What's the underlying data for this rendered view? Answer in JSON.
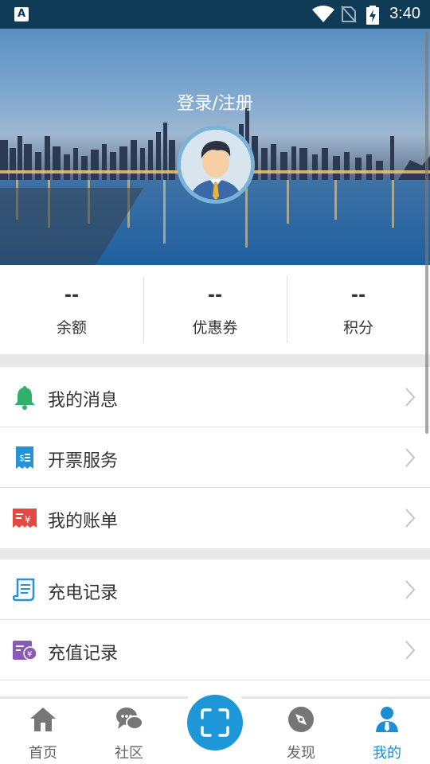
{
  "status_bar": {
    "time": "3:40",
    "app_badge": "A"
  },
  "header": {
    "login_text": "登录/注册"
  },
  "stats": [
    {
      "value": "--",
      "label": "余额"
    },
    {
      "value": "--",
      "label": "优惠券"
    },
    {
      "value": "--",
      "label": "积分"
    }
  ],
  "menu_group_1": [
    {
      "label": "我的消息",
      "icon": "bell-icon",
      "color": "#2fb06b"
    },
    {
      "label": "开票服务",
      "icon": "invoice-icon",
      "color": "#2793d6"
    },
    {
      "label": "我的账单",
      "icon": "bill-icon",
      "color": "#e4493f"
    }
  ],
  "menu_group_2": [
    {
      "label": "充电记录",
      "icon": "charge-record-icon",
      "color": "#2793d6"
    },
    {
      "label": "充值记录",
      "icon": "recharge-record-icon",
      "color": "#8a5bb3"
    }
  ],
  "bottom_nav": [
    {
      "label": "首页",
      "icon": "home-icon"
    },
    {
      "label": "社区",
      "icon": "community-icon"
    },
    {
      "label": "",
      "icon": "scan-icon"
    },
    {
      "label": "发现",
      "icon": "compass-icon"
    },
    {
      "label": "我的",
      "icon": "profile-icon",
      "active": true
    }
  ],
  "colors": {
    "accent": "#1a8fd6",
    "status_bar": "#0f3b57"
  }
}
